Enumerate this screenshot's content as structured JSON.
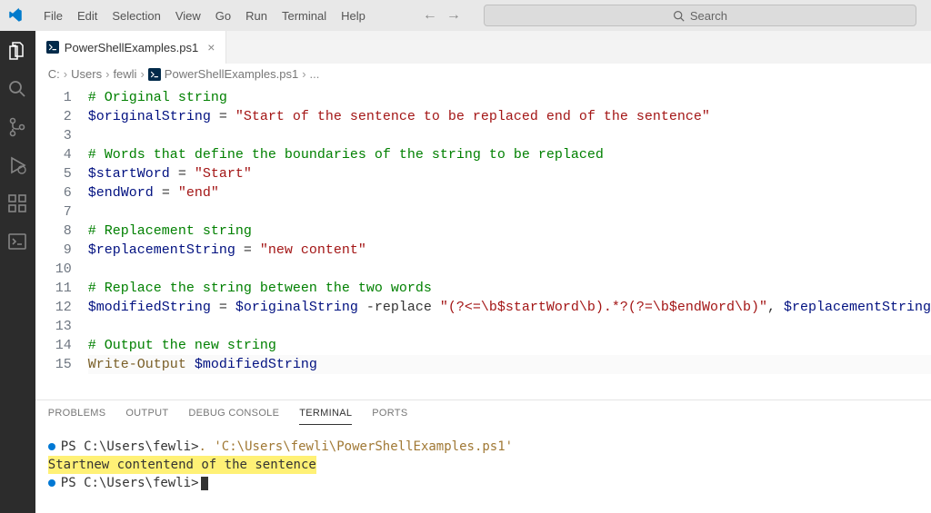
{
  "menu": [
    "File",
    "Edit",
    "Selection",
    "View",
    "Go",
    "Run",
    "Terminal",
    "Help"
  ],
  "search": {
    "placeholder": "Search"
  },
  "tab": {
    "filename": "PowerShellExamples.ps1"
  },
  "breadcrumb": {
    "parts": [
      "C:",
      "Users",
      "fewli",
      "PowerShellExamples.ps1"
    ],
    "ellipsis": "..."
  },
  "code": {
    "lines": [
      {
        "n": 1,
        "segments": [
          [
            "comment",
            "# Original string"
          ]
        ]
      },
      {
        "n": 2,
        "segments": [
          [
            "var",
            "$originalString"
          ],
          [
            "op",
            " = "
          ],
          [
            "string",
            "\"Start of the sentence to be replaced end of the sentence\""
          ]
        ]
      },
      {
        "n": 3,
        "segments": []
      },
      {
        "n": 4,
        "segments": [
          [
            "comment",
            "# Words that define the boundaries of the string to be replaced"
          ]
        ]
      },
      {
        "n": 5,
        "segments": [
          [
            "var",
            "$startWord"
          ],
          [
            "op",
            " = "
          ],
          [
            "string",
            "\"Start\""
          ]
        ]
      },
      {
        "n": 6,
        "segments": [
          [
            "var",
            "$endWord"
          ],
          [
            "op",
            " = "
          ],
          [
            "string",
            "\"end\""
          ]
        ]
      },
      {
        "n": 7,
        "segments": []
      },
      {
        "n": 8,
        "segments": [
          [
            "comment",
            "# Replacement string"
          ]
        ]
      },
      {
        "n": 9,
        "segments": [
          [
            "var",
            "$replacementString"
          ],
          [
            "op",
            " = "
          ],
          [
            "string",
            "\"new content\""
          ]
        ]
      },
      {
        "n": 10,
        "segments": []
      },
      {
        "n": 11,
        "segments": [
          [
            "comment",
            "# Replace the string between the two words"
          ]
        ]
      },
      {
        "n": 12,
        "segments": [
          [
            "var",
            "$modifiedString"
          ],
          [
            "op",
            " = "
          ],
          [
            "var",
            "$originalString"
          ],
          [
            "op",
            " -replace "
          ],
          [
            "string",
            "\"(?<=\\b$startWord\\b).*?(?=\\b$endWord\\b)\""
          ],
          [
            "op",
            ", "
          ],
          [
            "var",
            "$replacementString"
          ]
        ]
      },
      {
        "n": 13,
        "segments": []
      },
      {
        "n": 14,
        "segments": [
          [
            "comment",
            "# Output the new string"
          ]
        ]
      },
      {
        "n": 15,
        "current": true,
        "segments": [
          [
            "cmd",
            "Write-Output"
          ],
          [
            "op",
            " "
          ],
          [
            "var",
            "$modifiedString"
          ]
        ]
      }
    ]
  },
  "panel": {
    "tabs": [
      "PROBLEMS",
      "OUTPUT",
      "DEBUG CONSOLE",
      "TERMINAL",
      "PORTS"
    ],
    "active": "TERMINAL"
  },
  "terminal": {
    "line1_prefix": "PS C:\\Users\\fewli> ",
    "line1_path": ". 'C:\\Users\\fewli\\PowerShellExamples.ps1'",
    "line2_output": "Startnew contentend of the sentence",
    "line3_prefix": "PS C:\\Users\\fewli> "
  }
}
